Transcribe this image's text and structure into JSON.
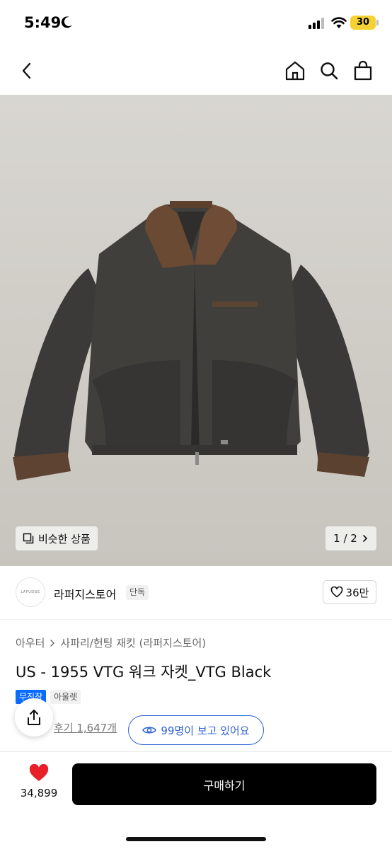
{
  "status_bar": {
    "time": "5:49",
    "battery": "30"
  },
  "nav": {
    "back_icon": "chevron-left-icon",
    "home_icon": "home-icon",
    "search_icon": "search-icon",
    "cart_icon": "shopping-bag-icon"
  },
  "image": {
    "similar_label": "비슷한 상품",
    "page_indicator": "1 / 2"
  },
  "store": {
    "logo_text": "LAFUDGE",
    "name": "라퍼지스토어",
    "tag": "단독",
    "like_count": "36만"
  },
  "product": {
    "breadcrumb": [
      "아우터",
      "사파리/헌팅 재킷 (라퍼지스토어)"
    ],
    "title": "US - 1955 VTG 워크 자켓_VTG Black",
    "badges": [
      "무진장",
      "아울렛"
    ],
    "review_link": "후기 1,647개",
    "viewers": "99명이 보고 있어요"
  },
  "bottom_bar": {
    "likes": "34,899",
    "buy_label": "구매하기"
  },
  "colors": {
    "accent_blue": "#2f63d6",
    "badge_blue": "#0a6bff",
    "heart_red": "#e8202a",
    "buy_black": "#000000"
  }
}
